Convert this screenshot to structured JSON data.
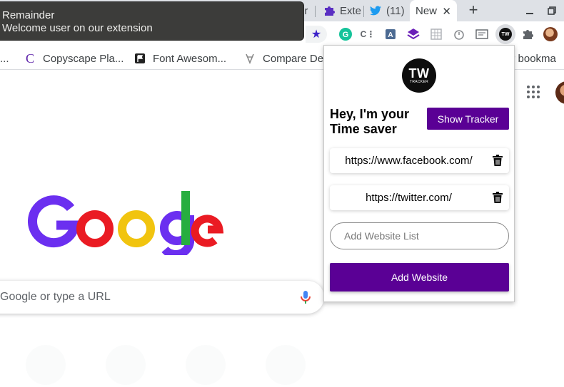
{
  "tabs": [
    {
      "label": "or",
      "icon": "page-icon"
    },
    {
      "label": "Exte",
      "icon": "puzzle-icon"
    },
    {
      "label": "(11)",
      "icon": "twitter-bird-icon"
    },
    {
      "label": "New",
      "icon": "close-icon",
      "active": true
    }
  ],
  "bookmarks": [
    {
      "label": "..."
    },
    {
      "label": "Copyscape Pla...",
      "icon": "copyscape-c-icon"
    },
    {
      "label": "Font Awesom...",
      "icon": "flag-icon"
    },
    {
      "label": "Compare Des",
      "icon": "compare-icon"
    },
    {
      "label": "er bookma"
    }
  ],
  "notification": {
    "title": "Remainder",
    "body": "Welcome user on our extension"
  },
  "search": {
    "placeholder": "Google or type a URL"
  },
  "popup": {
    "logo_main": "TW",
    "logo_sub": "TRACKER",
    "heading": "Hey, I'm your Time saver",
    "show_tracker_label": "Show Tracker",
    "sites": [
      {
        "url": "https://www.facebook.com/"
      },
      {
        "url": "https://twitter.com/"
      }
    ],
    "input_placeholder": "Add Website List",
    "add_button_label": "Add Website"
  },
  "colors": {
    "accent": "#5a0095",
    "notification_bg": "#3c3c3a",
    "google_blue": "#6b2ff0",
    "google_red": "#ea1b23",
    "google_yellow": "#f1c40f",
    "google_green": "#27ae3f"
  }
}
